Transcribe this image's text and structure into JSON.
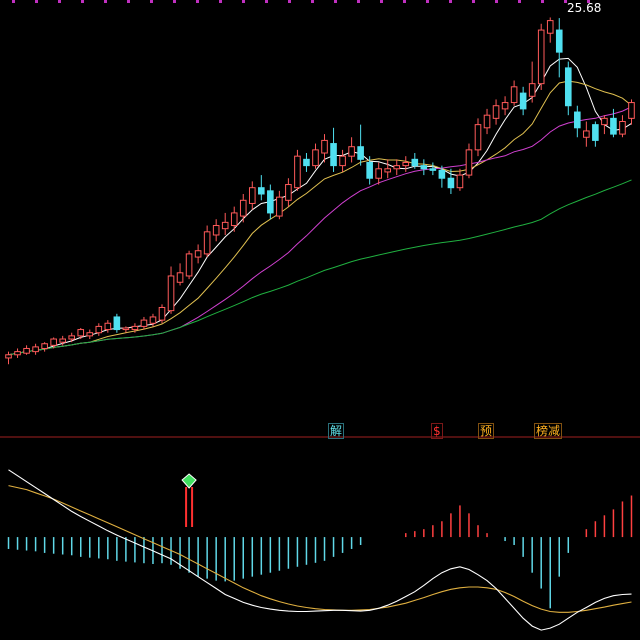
{
  "chart_data": [
    {
      "type": "candlestick",
      "title": "",
      "high_marker": "25.68",
      "up_color": "#ff5a5a",
      "down_color": "#50e0f0",
      "ylim": [
        14.2,
        26.0
      ],
      "candles": [
        [
          14.9,
          15.0,
          14.7,
          15.1
        ],
        [
          15.0,
          15.1,
          14.9,
          15.2
        ],
        [
          15.05,
          15.2,
          15.0,
          15.3
        ],
        [
          15.1,
          15.25,
          15.0,
          15.35
        ],
        [
          15.2,
          15.35,
          15.1,
          15.4
        ],
        [
          15.3,
          15.5,
          15.2,
          15.55
        ],
        [
          15.4,
          15.5,
          15.3,
          15.6
        ],
        [
          15.5,
          15.6,
          15.4,
          15.7
        ],
        [
          15.6,
          15.8,
          15.5,
          15.85
        ],
        [
          15.6,
          15.7,
          15.5,
          15.8
        ],
        [
          15.7,
          15.9,
          15.6,
          16.0
        ],
        [
          15.8,
          16.0,
          15.7,
          16.1
        ],
        [
          16.2,
          15.8,
          15.7,
          16.3
        ],
        [
          15.8,
          15.85,
          15.7,
          15.9
        ],
        [
          15.8,
          15.9,
          15.7,
          16.0
        ],
        [
          15.9,
          16.1,
          15.8,
          16.2
        ],
        [
          16.0,
          16.2,
          15.9,
          16.3
        ],
        [
          16.1,
          16.5,
          16.0,
          16.6
        ],
        [
          16.4,
          17.5,
          16.3,
          17.8
        ],
        [
          17.3,
          17.6,
          17.2,
          17.9
        ],
        [
          17.5,
          18.2,
          17.4,
          18.3
        ],
        [
          18.1,
          18.3,
          17.9,
          18.5
        ],
        [
          18.2,
          18.9,
          18.1,
          19.1
        ],
        [
          18.8,
          19.1,
          18.6,
          19.3
        ],
        [
          19.0,
          19.2,
          18.8,
          19.5
        ],
        [
          19.1,
          19.5,
          18.9,
          19.7
        ],
        [
          19.4,
          19.9,
          19.2,
          20.1
        ],
        [
          19.8,
          20.3,
          19.6,
          20.5
        ],
        [
          20.3,
          20.1,
          19.9,
          20.7
        ],
        [
          20.2,
          19.5,
          19.3,
          20.4
        ],
        [
          19.4,
          20.0,
          19.3,
          20.2
        ],
        [
          19.9,
          20.4,
          19.7,
          20.6
        ],
        [
          20.3,
          21.3,
          20.2,
          21.5
        ],
        [
          21.2,
          21.0,
          20.8,
          21.4
        ],
        [
          21.0,
          21.5,
          20.9,
          21.7
        ],
        [
          21.4,
          21.8,
          21.1,
          22.0
        ],
        [
          21.7,
          21.0,
          20.8,
          22.2
        ],
        [
          21.0,
          21.3,
          20.8,
          21.5
        ],
        [
          21.3,
          21.6,
          21.1,
          21.9
        ],
        [
          21.6,
          21.2,
          21.0,
          22.3
        ],
        [
          21.1,
          20.6,
          20.4,
          21.3
        ],
        [
          20.6,
          20.9,
          20.4,
          21.1
        ],
        [
          20.8,
          20.9,
          20.6,
          21.2
        ],
        [
          20.9,
          21.0,
          20.7,
          21.2
        ],
        [
          21.0,
          21.1,
          20.8,
          21.3
        ],
        [
          21.2,
          21.0,
          20.9,
          21.4
        ],
        [
          21.0,
          20.9,
          20.7,
          21.2
        ],
        [
          20.9,
          20.85,
          20.7,
          21.1
        ],
        [
          20.85,
          20.6,
          20.3,
          21.0
        ],
        [
          20.6,
          20.3,
          20.1,
          20.9
        ],
        [
          20.3,
          20.7,
          20.2,
          20.9
        ],
        [
          20.7,
          21.5,
          20.6,
          21.7
        ],
        [
          21.5,
          22.3,
          21.3,
          22.5
        ],
        [
          22.2,
          22.6,
          22.0,
          22.8
        ],
        [
          22.5,
          22.9,
          22.3,
          23.1
        ],
        [
          22.8,
          23.0,
          22.6,
          23.2
        ],
        [
          23.0,
          23.5,
          22.9,
          23.7
        ],
        [
          23.3,
          22.8,
          22.6,
          23.5
        ],
        [
          23.2,
          23.6,
          23.0,
          24.3
        ],
        [
          23.6,
          25.3,
          23.4,
          25.5
        ],
        [
          25.2,
          25.6,
          24.9,
          25.7
        ],
        [
          25.3,
          24.6,
          23.8,
          25.68
        ],
        [
          24.1,
          22.9,
          22.6,
          24.3
        ],
        [
          22.7,
          22.2,
          21.9,
          22.9
        ],
        [
          21.9,
          22.1,
          21.6,
          22.4
        ],
        [
          22.3,
          21.8,
          21.6,
          22.4
        ],
        [
          22.3,
          22.5,
          22.0,
          22.6
        ],
        [
          22.5,
          22.0,
          21.9,
          22.8
        ],
        [
          22.0,
          22.4,
          21.9,
          22.6
        ],
        [
          22.5,
          23.0,
          22.3,
          23.1
        ]
      ],
      "ma_colors": [
        "#ffffff",
        "#e0c050",
        "#d040d0",
        "#20b040"
      ]
    },
    {
      "type": "macd",
      "signals": [
        "解",
        "$",
        "预",
        "榜减"
      ],
      "hist_pos_color": "#ff4040",
      "hist_neg_color": "#60d8e8",
      "dif_color": "#ffffff",
      "dea_color": "#e0b040",
      "hist": [
        -0.3,
        -0.32,
        -0.34,
        -0.36,
        -0.4,
        -0.42,
        -0.44,
        -0.46,
        -0.5,
        -0.52,
        -0.54,
        -0.56,
        -0.6,
        -0.62,
        -0.64,
        -0.66,
        -0.68,
        -0.66,
        -0.7,
        -0.8,
        -0.9,
        -1.0,
        -1.05,
        -1.1,
        -1.12,
        -1.1,
        -1.05,
        -1.0,
        -0.95,
        -0.9,
        -0.85,
        -0.8,
        -0.75,
        -0.7,
        -0.65,
        -0.6,
        -0.5,
        -0.4,
        -0.3,
        -0.2,
        0,
        0,
        0,
        0,
        0.1,
        0.15,
        0.2,
        0.3,
        0.4,
        0.6,
        0.8,
        0.6,
        0.3,
        0.1,
        0,
        -0.1,
        -0.2,
        -0.5,
        -0.9,
        -1.3,
        -1.8,
        -1.0,
        -0.4,
        0,
        0.2,
        0.4,
        0.55,
        0.7,
        0.9,
        1.05
      ],
      "dif": [
        1.7,
        1.55,
        1.4,
        1.25,
        1.1,
        0.95,
        0.8,
        0.65,
        0.52,
        0.4,
        0.28,
        0.16,
        0.05,
        -0.05,
        -0.15,
        -0.25,
        -0.35,
        -0.45,
        -0.55,
        -0.7,
        -0.85,
        -1.0,
        -1.15,
        -1.3,
        -1.45,
        -1.55,
        -1.65,
        -1.72,
        -1.78,
        -1.82,
        -1.85,
        -1.87,
        -1.88,
        -1.88,
        -1.87,
        -1.86,
        -1.85,
        -1.85,
        -1.86,
        -1.87,
        -1.85,
        -1.8,
        -1.72,
        -1.62,
        -1.5,
        -1.38,
        -1.22,
        -1.05,
        -0.9,
        -0.8,
        -0.75,
        -0.82,
        -0.95,
        -1.1,
        -1.3,
        -1.55,
        -1.8,
        -2.05,
        -2.25,
        -2.35,
        -2.3,
        -2.2,
        -2.05,
        -1.9,
        -1.78,
        -1.65,
        -1.55,
        -1.48,
        -1.45,
        -1.44
      ],
      "dea": [
        1.3,
        1.25,
        1.2,
        1.12,
        1.04,
        0.96,
        0.86,
        0.76,
        0.66,
        0.56,
        0.46,
        0.36,
        0.26,
        0.16,
        0.06,
        -0.04,
        -0.14,
        -0.24,
        -0.34,
        -0.44,
        -0.56,
        -0.68,
        -0.8,
        -0.92,
        -1.04,
        -1.16,
        -1.28,
        -1.38,
        -1.48,
        -1.56,
        -1.63,
        -1.69,
        -1.74,
        -1.78,
        -1.81,
        -1.83,
        -1.84,
        -1.85,
        -1.85,
        -1.84,
        -1.83,
        -1.8,
        -1.77,
        -1.72,
        -1.67,
        -1.6,
        -1.53,
        -1.45,
        -1.38,
        -1.32,
        -1.28,
        -1.26,
        -1.26,
        -1.28,
        -1.32,
        -1.4,
        -1.5,
        -1.62,
        -1.73,
        -1.82,
        -1.88,
        -1.9,
        -1.9,
        -1.88,
        -1.85,
        -1.81,
        -1.77,
        -1.72,
        -1.68,
        -1.64
      ],
      "ylim": [
        -2.6,
        2.2
      ]
    }
  ]
}
